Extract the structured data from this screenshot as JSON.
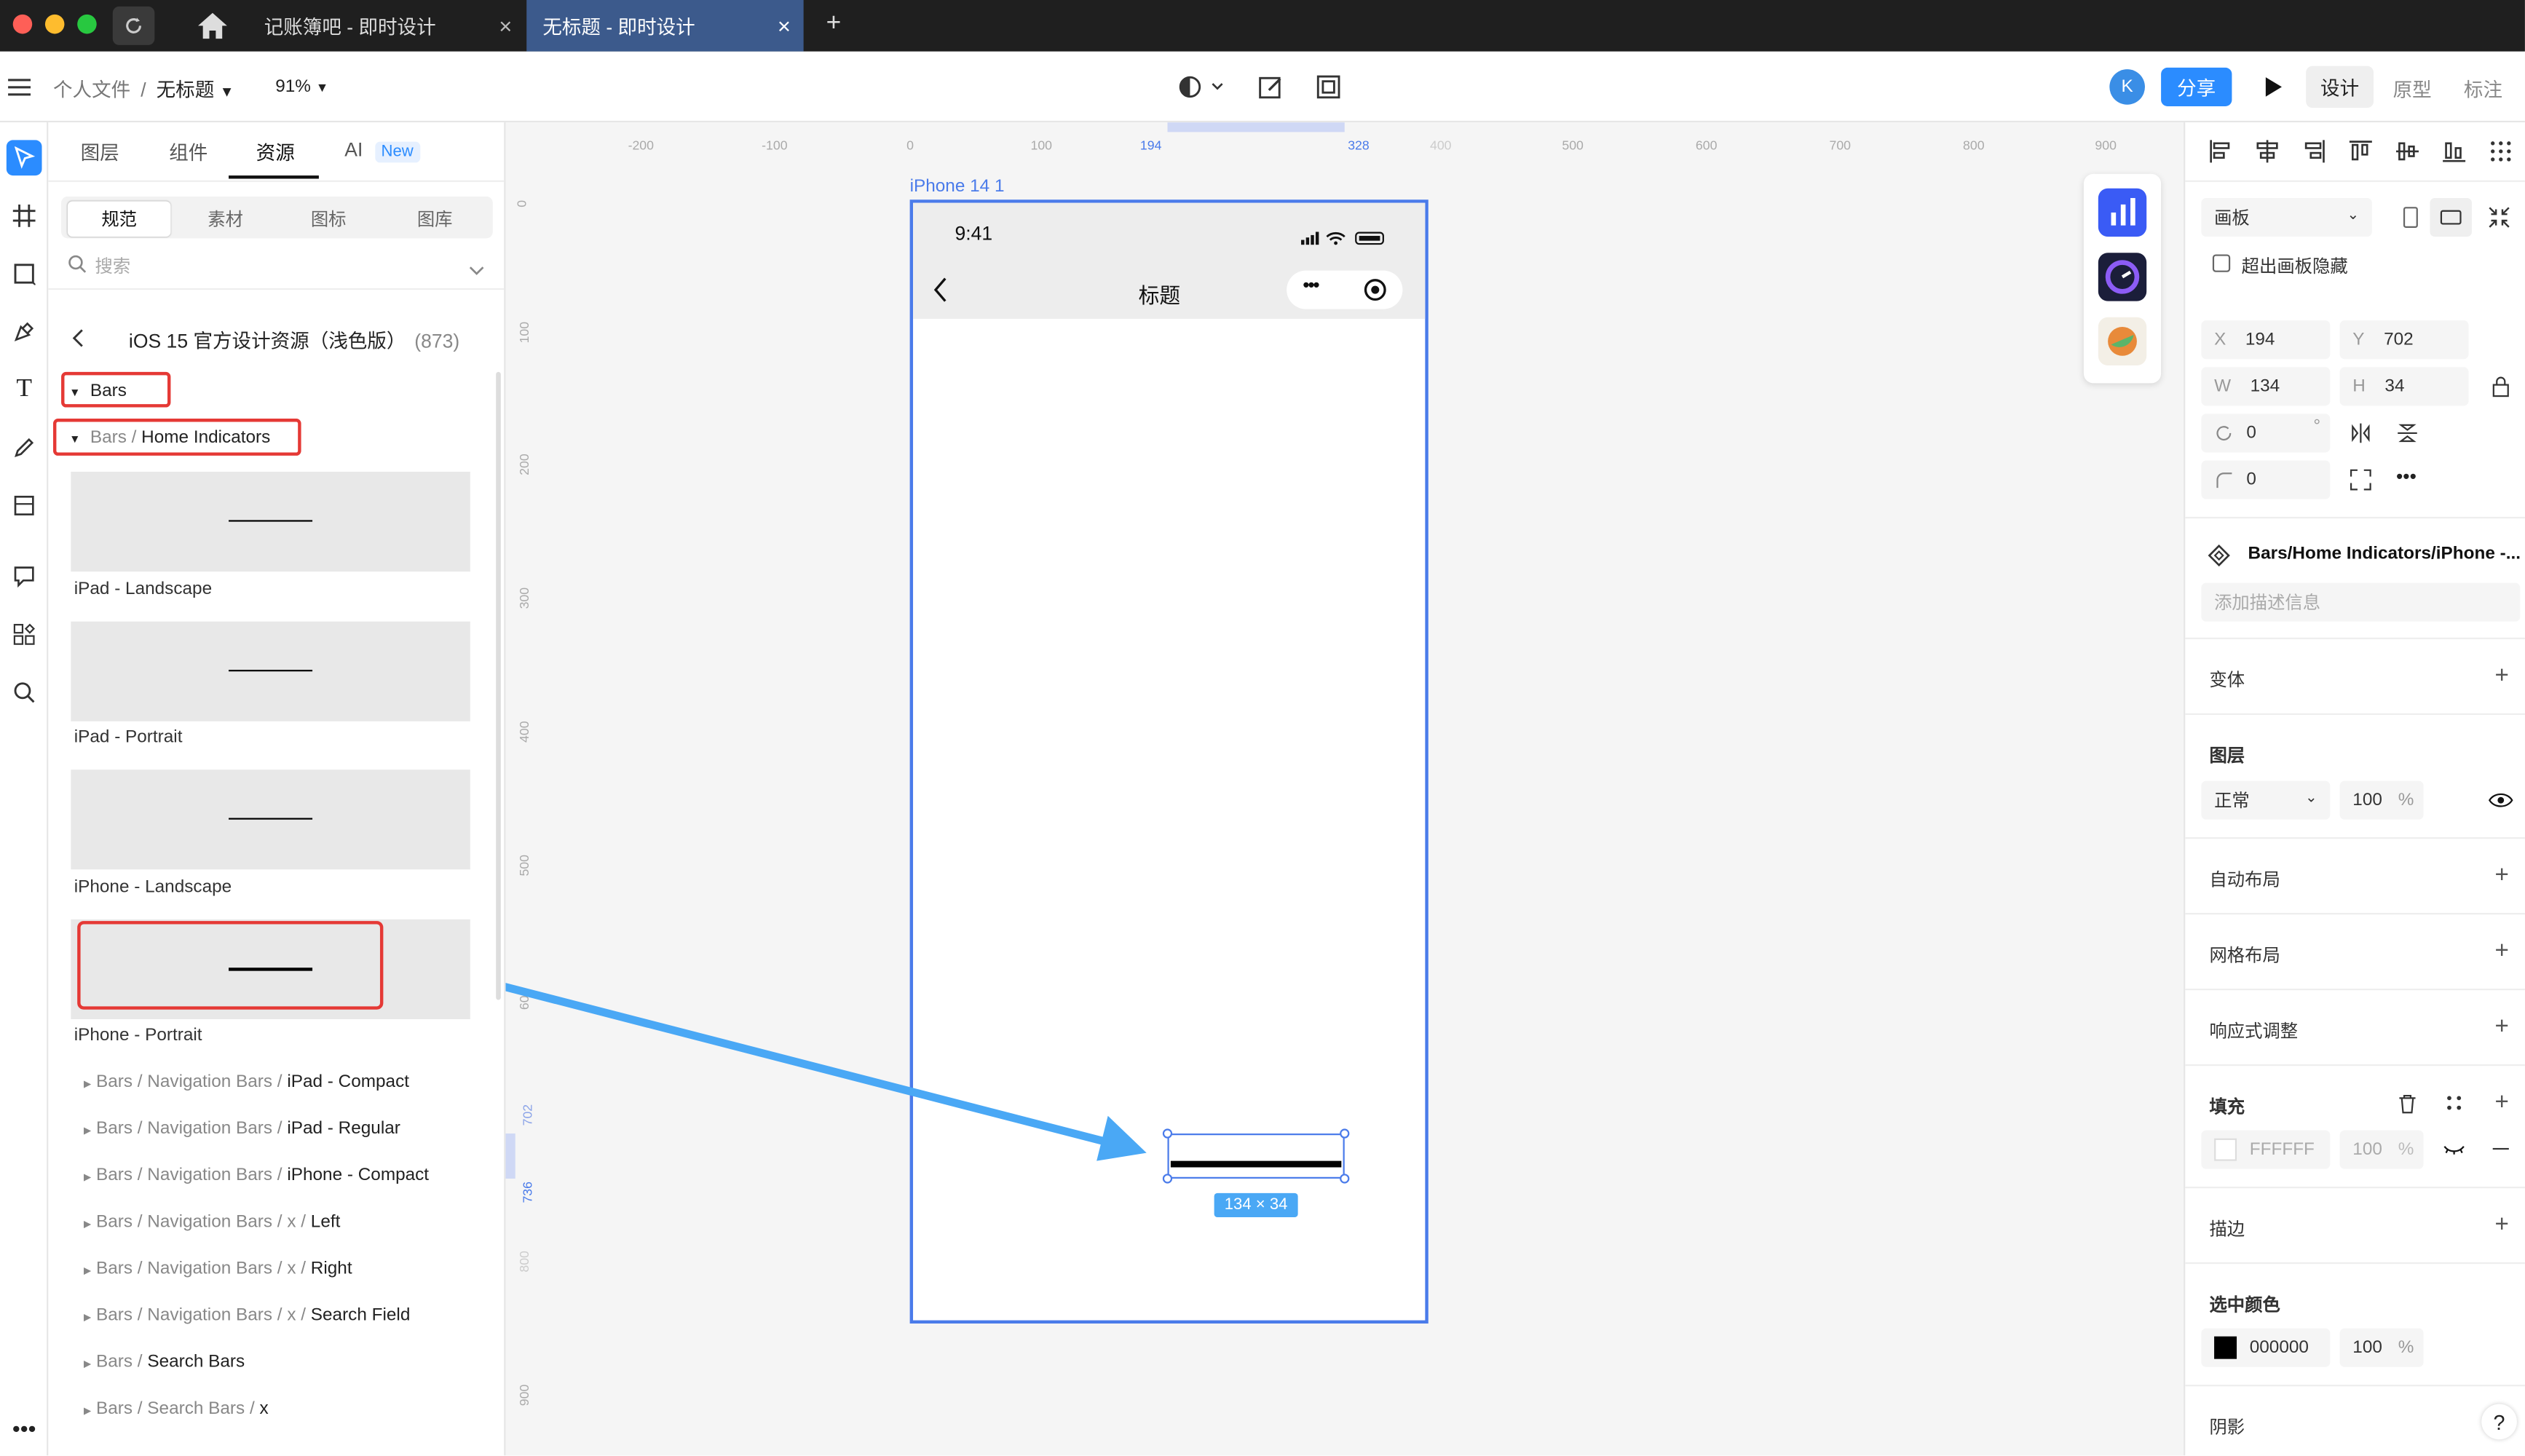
{
  "titlebar": {
    "tabs": [
      {
        "label": "记账簿吧 - 即时设计"
      },
      {
        "label": "无标题 - 即时设计"
      }
    ],
    "new_tab": "+"
  },
  "toolbar": {
    "breadcrumb_parent": "个人文件",
    "breadcrumb_sep": "/",
    "file_name": "无标题",
    "zoom": "91%",
    "avatar_letter": "K",
    "share_label": "分享",
    "modes": [
      "设计",
      "原型",
      "标注"
    ]
  },
  "left_panel": {
    "tabs": [
      "图层",
      "组件",
      "资源",
      "AI"
    ],
    "ai_badge": "New",
    "subtabs": [
      "规范",
      "素材",
      "图标",
      "图库"
    ],
    "search_placeholder": "搜索",
    "library_title": "iOS 15 官方设计资源（浅色版）",
    "library_count": "(873)",
    "tree_bars": "Bars",
    "tree_home_prefix": "Bars / ",
    "tree_home": "Home Indicators",
    "thumbs": [
      "iPad - Landscape",
      "iPad - Portrait",
      "iPhone - Landscape",
      "iPhone - Portrait"
    ],
    "items": [
      {
        "prefix": "Bars / Navigation Bars / ",
        "name": "iPad - Compact"
      },
      {
        "prefix": "Bars / Navigation Bars / ",
        "name": "iPad - Regular"
      },
      {
        "prefix": "Bars / Navigation Bars / ",
        "name": "iPhone - Compact"
      },
      {
        "prefix": "Bars / Navigation Bars / x / ",
        "name": "Left"
      },
      {
        "prefix": "Bars / Navigation Bars / x / ",
        "name": "Right"
      },
      {
        "prefix": "Bars / Navigation Bars / x / ",
        "name": "Search Field"
      },
      {
        "prefix": "Bars / ",
        "name": "Search Bars"
      },
      {
        "prefix": "Bars / Search Bars / ",
        "name": "x"
      }
    ]
  },
  "canvas": {
    "h_ruler": [
      "-200",
      "-100",
      "0",
      "100",
      "194",
      "328",
      "400",
      "500",
      "600",
      "700",
      "800",
      "900"
    ],
    "v_ruler": [
      "0",
      "100",
      "200",
      "300",
      "400",
      "500",
      "600",
      "702",
      "736",
      "800",
      "900"
    ],
    "frame_label": "iPhone 14 1",
    "status_time": "9:41",
    "nav_title": "标题",
    "selection_size": "134 × 34"
  },
  "right_panel": {
    "frame_type": "画板",
    "clip_label": "超出画板隐藏",
    "x_label": "X",
    "x": "194",
    "y_label": "Y",
    "y": "702",
    "w_label": "W",
    "w": "134",
    "h_label": "H",
    "h": "34",
    "rotation": "0",
    "degree": "°",
    "radius": "0",
    "component_name": "Bars/Home Indicators/iPhone -...",
    "desc_placeholder": "添加描述信息",
    "variants": "变体",
    "layer": "图层",
    "blend": "正常",
    "opacity": "100",
    "percent": "%",
    "auto_layout": "自动布局",
    "grid_layout": "网格布局",
    "responsive": "响应式调整",
    "fill": "填充",
    "fill_hex": "FFFFFF",
    "fill_opacity": "100",
    "stroke": "描边",
    "selected_colors": "选中颜色",
    "sel_hex": "000000",
    "sel_opacity": "100",
    "shadow": "阴影",
    "help": "?"
  },
  "colors": {
    "accent": "#2b8cff",
    "frame_border": "#4a7bea",
    "arrow": "#4aa8f5",
    "highlight": "#e53935"
  }
}
